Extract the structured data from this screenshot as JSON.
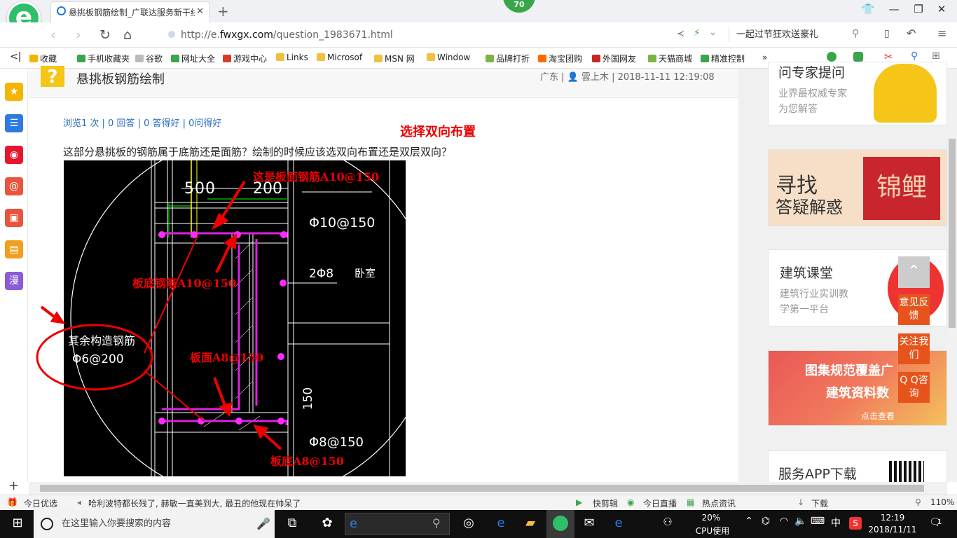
{
  "browser": {
    "tab_title": "悬挑板钢筋绘制_广联达服务新干线",
    "tab_close": "✕",
    "new_tab": "+",
    "badge_number": "70",
    "url_prefix": "http://e.",
    "url_domain": "fwxgx.com",
    "url_path": "/question_1983671.html",
    "search_text": "一起过节狂欢送豪礼"
  },
  "bookmarks": [
    {
      "label": "收藏",
      "color": "#f5b400"
    },
    {
      "label": "手机收藏夹",
      "color": "#3aa64a"
    },
    {
      "label": "谷歌",
      "color": "#bbbbbb"
    },
    {
      "label": "网址大全",
      "color": "#3aa64a"
    },
    {
      "label": "游戏中心",
      "color": "#d83b2b"
    },
    {
      "label": "Links",
      "color": "#f0c040"
    },
    {
      "label": "Microsof",
      "color": "#f0c040"
    },
    {
      "label": "MSN 网",
      "color": "#f0c040"
    },
    {
      "label": "Window",
      "color": "#f0c040"
    },
    {
      "label": "品牌打折",
      "color": "#7cb342"
    },
    {
      "label": "淘宝团购",
      "color": "#ff6a00"
    },
    {
      "label": "外国网友",
      "color": "#c62828"
    },
    {
      "label": "天猫商城",
      "color": "#7cb342"
    },
    {
      "label": "精准控制",
      "color": "#3aa64a"
    }
  ],
  "sidebar_icons": [
    {
      "name": "favorites",
      "glyph": "★",
      "color": "#f5b400"
    },
    {
      "name": "news",
      "glyph": "☰",
      "color": "#2d7be0"
    },
    {
      "name": "weibo",
      "glyph": "◉",
      "color": "#e6162d"
    },
    {
      "name": "mail",
      "glyph": "@",
      "color": "#e8553c"
    },
    {
      "name": "game",
      "glyph": "▣",
      "color": "#e8553c"
    },
    {
      "name": "novel",
      "glyph": "▤",
      "color": "#f0a020"
    },
    {
      "name": "comic",
      "glyph": "漫",
      "color": "#8a5cd6"
    }
  ],
  "question": {
    "title": "悬挑板钢筋绘制",
    "meta": "广东 | 👤 雲上木 | 2018-11-11 12:19:08",
    "stats": "浏览1 次 | 0 回答 | 0 答得好 | 0问得好",
    "annotation_top": "选择双向布置",
    "body": "这部分悬挑板的钢筋属于底筋还是面筋？绘制的时候应该选双向布置还是双层双向？"
  },
  "drawing": {
    "dim_500": "500",
    "dim_200": "200",
    "label_top_rebar": "这是板面钢筋A10@150",
    "label_phi10": "Φ10@150",
    "label_bottom_rebar": "板底钢筋A10@150",
    "label_2phi8": "2Φ8",
    "label_bedroom": "卧室",
    "label_other_rebar": "其余构造钢筋",
    "label_phi6": "Φ6@200",
    "label_face_a8": "板面A8@150",
    "label_150": "150",
    "label_phi8": "Φ8@150",
    "label_bottom_a8": "板底A8@150"
  },
  "right_panel": {
    "card1_title": "问专家提问",
    "card1_sub1": "业界最权威专家",
    "card1_sub2": "为您解答",
    "card2_line1": "寻找",
    "card2_line2": "答疑解惑",
    "card2_seal": "锦鲤",
    "card3_title": "建筑课堂",
    "card3_sub1": "建筑行业实训教",
    "card3_sub2": "学第一平台",
    "card4_line1": "图集规范覆盖广",
    "card4_line2": "建筑资料数",
    "card4_btn": "点击查看",
    "card5_title": "服务APP下载",
    "feedback": "意见反馈",
    "follow": "关注我们",
    "qq": "Q Q咨询"
  },
  "statusbar": {
    "today": "今日优选",
    "news": "哈利波特都长残了, 赫敏一直美到大, 最丑的他现在帅呆了",
    "clip": "快剪辑",
    "live": "今日直播",
    "hot": "热点资讯",
    "download": "下载",
    "zoom": "110%"
  },
  "taskbar": {
    "search_placeholder": "在这里输入你要搜索的内容",
    "cpu_percent": "20%",
    "cpu_label": "CPU使用",
    "ime": "中",
    "time": "12:19",
    "date": "2018/11/11",
    "notifications": "1"
  }
}
